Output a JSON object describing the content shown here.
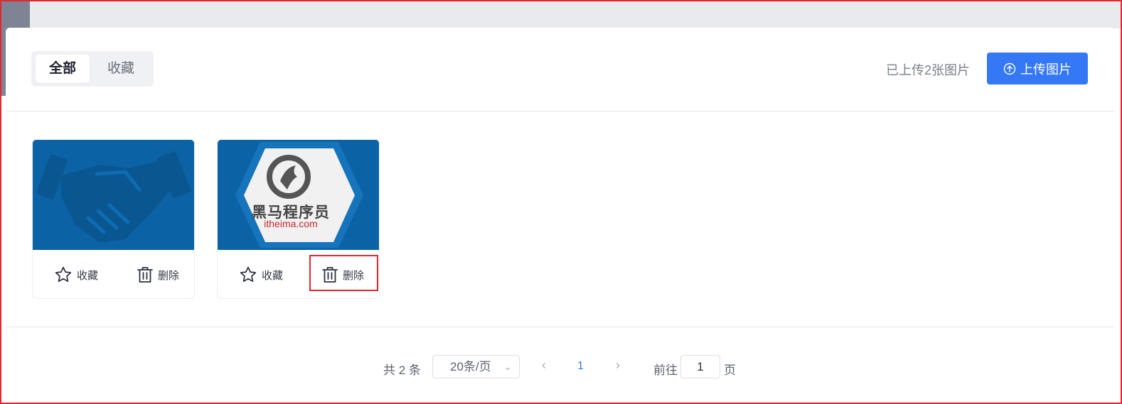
{
  "tabs": {
    "all": "全部",
    "favorites": "收藏"
  },
  "header": {
    "upload_count": "已上传2张图片",
    "upload_button": "上传图片"
  },
  "images": [
    {
      "thumb": "handshake-image",
      "fav_label": "收藏",
      "delete_label": "删除"
    },
    {
      "thumb": "itheima-logo-image",
      "logo_title": "黑马程序员",
      "logo_url": "itheima.com",
      "fav_label": "收藏",
      "delete_label": "删除"
    }
  ],
  "pagination": {
    "total": "共 2 条",
    "page_size": "20条/页",
    "current_page": "1",
    "goto_label": "前往",
    "goto_value": "1",
    "page_unit": "页"
  },
  "colors": {
    "accent": "#3478f6",
    "highlight_border": "#e0282e",
    "thumb_blue": "#0b63a6"
  },
  "icons": [
    "upload-icon",
    "star-icon",
    "trash-icon",
    "chevron-down-icon",
    "chevron-left-icon",
    "chevron-right-icon"
  ]
}
